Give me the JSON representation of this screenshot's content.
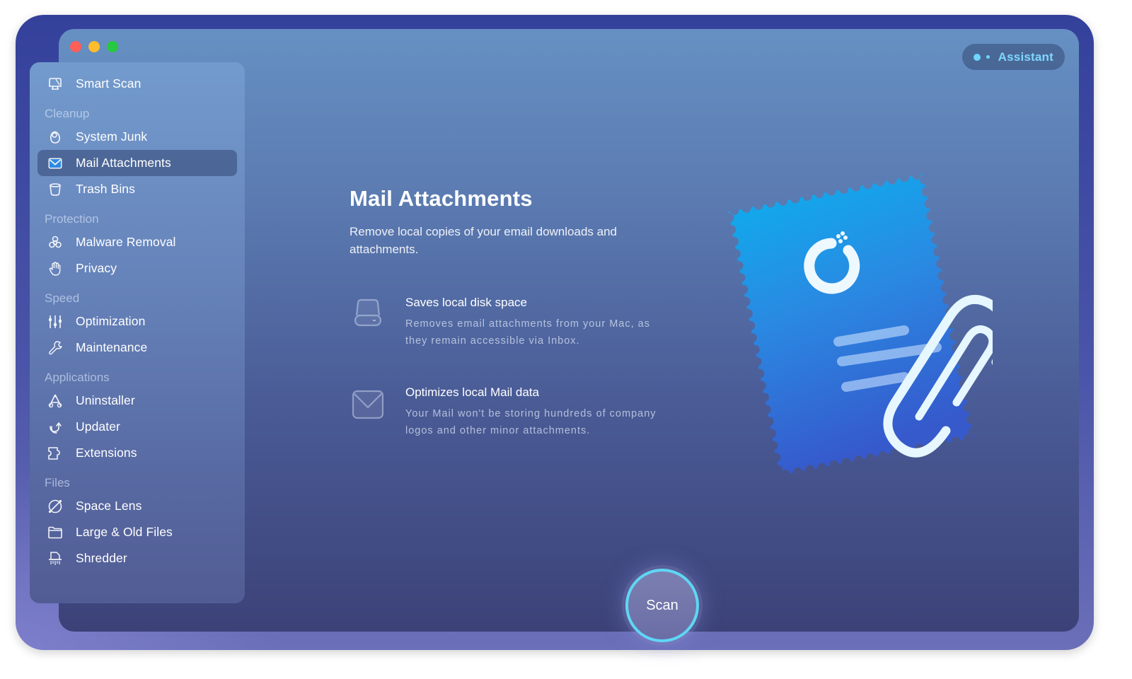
{
  "window": {
    "traffic_lights": [
      "close",
      "minimize",
      "zoom"
    ]
  },
  "assistant": {
    "label": "Assistant",
    "icon": "assistant-dots-icon"
  },
  "sidebar": {
    "items": [
      {
        "type": "item",
        "label": "Smart Scan",
        "icon": "smart-scan-icon",
        "active": false
      },
      {
        "type": "header",
        "label": "Cleanup"
      },
      {
        "type": "item",
        "label": "System Junk",
        "icon": "system-junk-icon",
        "active": false
      },
      {
        "type": "item",
        "label": "Mail Attachments",
        "icon": "mail-icon",
        "active": true
      },
      {
        "type": "item",
        "label": "Trash Bins",
        "icon": "trash-icon",
        "active": false
      },
      {
        "type": "header",
        "label": "Protection"
      },
      {
        "type": "item",
        "label": "Malware Removal",
        "icon": "biohazard-icon",
        "active": false
      },
      {
        "type": "item",
        "label": "Privacy",
        "icon": "hand-icon",
        "active": false
      },
      {
        "type": "header",
        "label": "Speed"
      },
      {
        "type": "item",
        "label": "Optimization",
        "icon": "sliders-icon",
        "active": false
      },
      {
        "type": "item",
        "label": "Maintenance",
        "icon": "wrench-icon",
        "active": false
      },
      {
        "type": "header",
        "label": "Applications"
      },
      {
        "type": "item",
        "label": "Uninstaller",
        "icon": "uninstaller-icon",
        "active": false
      },
      {
        "type": "item",
        "label": "Updater",
        "icon": "updater-icon",
        "active": false
      },
      {
        "type": "item",
        "label": "Extensions",
        "icon": "extensions-icon",
        "active": false
      },
      {
        "type": "header",
        "label": "Files"
      },
      {
        "type": "item",
        "label": "Space Lens",
        "icon": "space-lens-icon",
        "active": false
      },
      {
        "type": "item",
        "label": "Large & Old Files",
        "icon": "folder-icon",
        "active": false
      },
      {
        "type": "item",
        "label": "Shredder",
        "icon": "shredder-icon",
        "active": false
      }
    ]
  },
  "main": {
    "title": "Mail Attachments",
    "description": "Remove local copies of your email downloads and attachments.",
    "features": [
      {
        "icon": "disk-icon",
        "title": "Saves local disk space",
        "text": "Removes email attachments from your Mac, as they remain accessible via Inbox."
      },
      {
        "icon": "envelope-icon",
        "title": "Optimizes local Mail data",
        "text": "Your Mail won't be storing hundreds of company logos and other minor attachments."
      }
    ],
    "illustration": "mail-stamp-paperclip-illustration"
  },
  "scan_button": {
    "label": "Scan"
  },
  "colors": {
    "accent_cyan": "#5fd6f5",
    "assistant_text": "#7fd6ff",
    "stamp_blue": "#1f8fe6"
  }
}
